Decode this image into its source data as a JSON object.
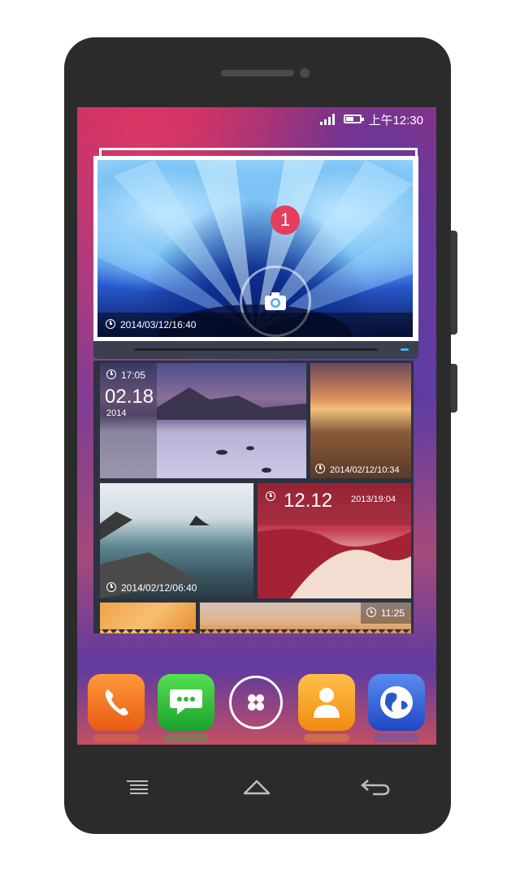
{
  "status_bar": {
    "time": "上午12:30",
    "signal_icon": "signal-icon",
    "battery_icon": "battery-icon"
  },
  "hero_widget": {
    "notification_count": "1",
    "timestamp": "2014/03/12/16:40",
    "icon": "camera-icon"
  },
  "gallery": {
    "tiles": [
      {
        "time": "17:05",
        "date_big": "02.18",
        "year": "2014"
      },
      {
        "timestamp": "2014/02/12/10:34"
      },
      {
        "timestamp": "2014/02/12/06:40"
      },
      {
        "date_big": "12.12",
        "subtext": "2013/19:04"
      },
      {
        "time": "11:25"
      }
    ]
  },
  "dock": {
    "apps": [
      "phone-icon",
      "messages-icon",
      "app-drawer-icon",
      "contacts-icon",
      "browser-icon"
    ]
  },
  "nav_bar": [
    "menu-icon",
    "home-icon",
    "back-icon"
  ],
  "colors": {
    "badge": "#e53d5c",
    "phone_app": "#f47a1f",
    "messages_app": "#2fb842",
    "contacts_app": "#f7a21f",
    "browser_app": "#3060d8"
  }
}
